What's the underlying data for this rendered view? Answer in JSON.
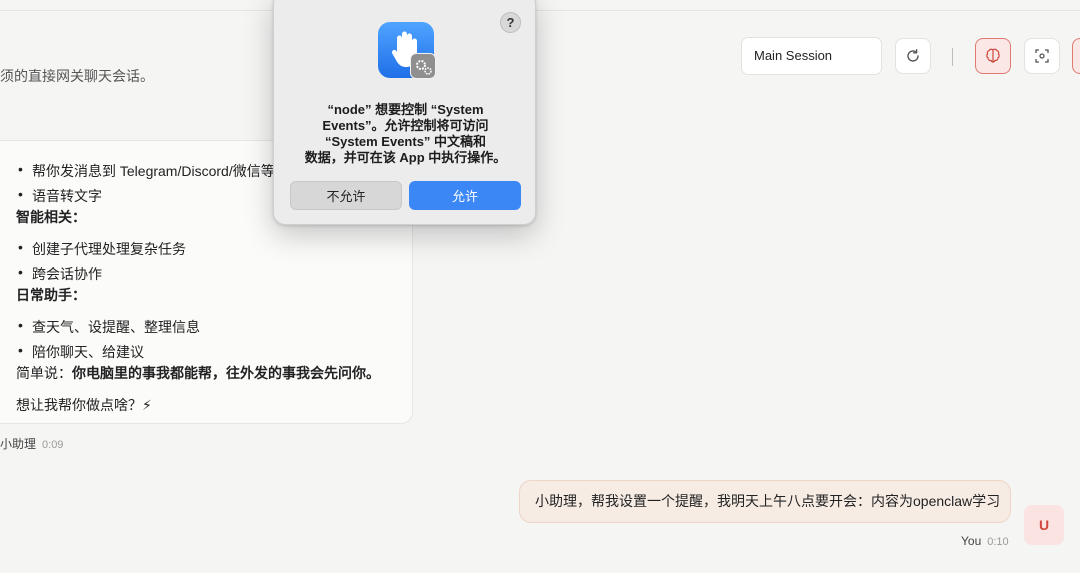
{
  "header": {
    "subtitle": "须的直接网关聊天会话。",
    "session_value": "Main Session"
  },
  "toolbar": {
    "refresh_icon": "refresh-icon",
    "brain_icon": "brain-icon",
    "focus_icon": "focus-scan-icon",
    "accent": "#e07a71"
  },
  "assistant": {
    "lines": [
      "帮你发消息到 Telegram/Discord/微信等",
      "语音转文字",
      "智能相关：",
      "创建子代理处理复杂任务",
      "跨会话协作",
      "日常助手：",
      "查天气、设提醒、整理信息",
      "陪你聊天、给建议",
      "简单说：",
      "你电脑里的事我都能帮，往外发的事我会先问你。",
      "想让我帮你做点啥？⚡"
    ],
    "name": "小助理",
    "time": "0:09"
  },
  "user": {
    "message": "小助理，帮我设置一个提醒，我明天上午八点要开会：内容为openclaw学习",
    "avatar": "U",
    "name": "You",
    "time": "0:10"
  },
  "dialog": {
    "help": "?",
    "line1": "“node” 想要控制 “System",
    "line2": "Events”。允许控制将可访问",
    "line3": "“System Events” 中文稿和",
    "line4": "数据，并可在该 App 中执行操作。",
    "deny_label": "不允许",
    "allow_label": "允许",
    "allow_color": "#3b87f6"
  }
}
